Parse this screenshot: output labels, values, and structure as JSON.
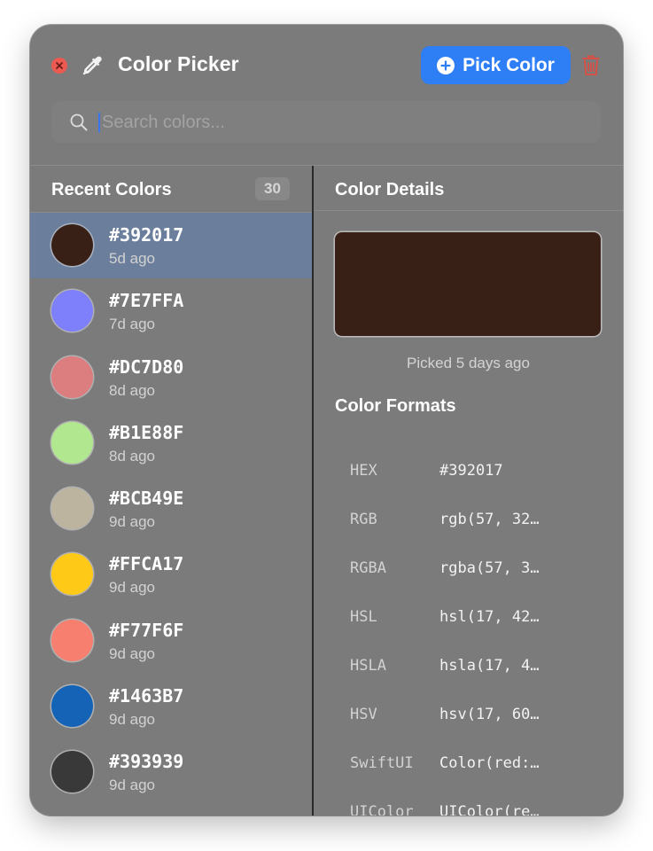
{
  "window": {
    "title": "Color Picker",
    "icons": {
      "close": "close-icon",
      "dropper": "eyedropper-icon",
      "trash": "trash-icon",
      "search": "search-icon",
      "add": "plus-circle-icon"
    },
    "colors": {
      "accent": "#2e7ef5",
      "close": "#ec5a52",
      "trash": "#e24a3f",
      "selection": "#6b7f9c"
    }
  },
  "toolbar": {
    "pick_label": "Pick Color"
  },
  "search": {
    "placeholder": "Search colors...",
    "value": ""
  },
  "recent": {
    "title": "Recent Colors",
    "count": "30",
    "selected_index": 0,
    "items": [
      {
        "hex": "#392017",
        "ago": "5d ago",
        "color": "#392017"
      },
      {
        "hex": "#7E7FFA",
        "ago": "7d ago",
        "color": "#7E7FFA"
      },
      {
        "hex": "#DC7D80",
        "ago": "8d ago",
        "color": "#DC7D80"
      },
      {
        "hex": "#B1E88F",
        "ago": "8d ago",
        "color": "#B1E88F"
      },
      {
        "hex": "#BCB49E",
        "ago": "9d ago",
        "color": "#BCB49E"
      },
      {
        "hex": "#FFCA17",
        "ago": "9d ago",
        "color": "#FFCA17"
      },
      {
        "hex": "#F77F6F",
        "ago": "9d ago",
        "color": "#F77F6F"
      },
      {
        "hex": "#1463B7",
        "ago": "9d ago",
        "color": "#1463B7"
      },
      {
        "hex": "#393939",
        "ago": "9d ago",
        "color": "#393939"
      }
    ]
  },
  "details": {
    "title": "Color Details",
    "preview_color": "#392017",
    "picked_text": "Picked 5 days ago",
    "formats_title": "Color Formats",
    "formats": [
      {
        "label": "HEX",
        "value": "#392017"
      },
      {
        "label": "RGB",
        "value": "rgb(57, 32…"
      },
      {
        "label": "RGBA",
        "value": "rgba(57, 3…"
      },
      {
        "label": "HSL",
        "value": "hsl(17, 42…"
      },
      {
        "label": "HSLA",
        "value": "hsla(17, 4…"
      },
      {
        "label": "HSV",
        "value": "hsv(17, 60…"
      },
      {
        "label": "SwiftUI",
        "value": "Color(red:…"
      },
      {
        "label": "UIColor",
        "value": "UIColor(re…"
      }
    ]
  }
}
